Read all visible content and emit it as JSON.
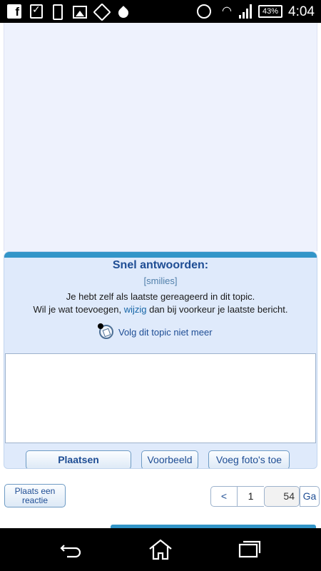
{
  "status_bar": {
    "battery": "43%",
    "time": "4:04",
    "icons": [
      "facebook-icon",
      "checklist-icon",
      "phone-icon",
      "gallery-icon",
      "tag-icon",
      "drop-icon",
      "alarm-icon",
      "wifi-icon",
      "signal-icon",
      "battery-icon"
    ]
  },
  "reply": {
    "title": "Snel antwoorden:",
    "smilies": "[smilies]",
    "notice_line1": "Je hebt zelf als laatste gereageerd in dit topic.",
    "notice_line2_before": "Wil je wat toevoegen, ",
    "notice_link": "wijzig",
    "notice_line2_after": " dan bij voorkeur je laatste bericht.",
    "follow_label": "Volg dit topic niet meer",
    "textarea_value": "",
    "buttons": {
      "post": "Plaatsen",
      "preview": "Voorbeeld",
      "photos": "Voeg foto's toe"
    }
  },
  "footer": {
    "post_reply_line1": "Plaats een",
    "post_reply_line2": "reactie",
    "pager": {
      "prev": "<",
      "page": "1",
      "input_value": "54",
      "go": "Ga"
    }
  },
  "nav": {
    "icons": [
      "back-icon",
      "home-icon",
      "recent-apps-icon"
    ]
  }
}
